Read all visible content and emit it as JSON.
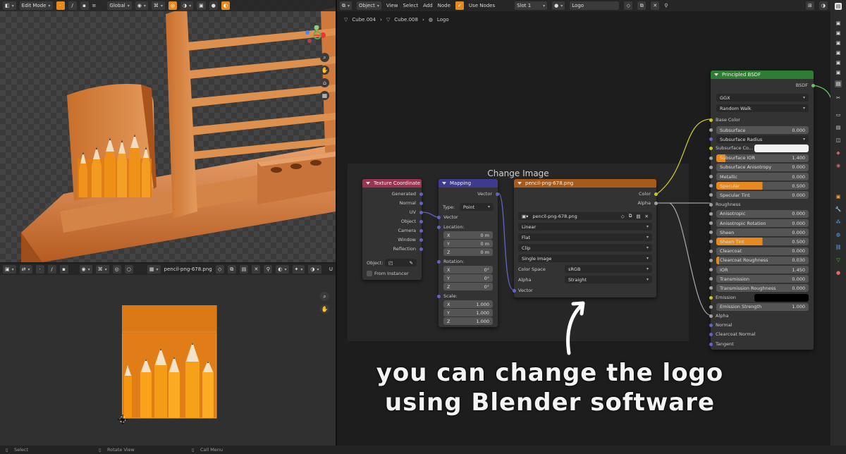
{
  "viewport": {
    "mode": "Edit Mode",
    "orientation": "Global"
  },
  "image_editor": {
    "image_name": "pencil-png-678.png",
    "status_select": "Select",
    "status_rotate": "Rotate View",
    "status_call": "Call Menu",
    "label_u": "U"
  },
  "node_editor": {
    "object_menu": "Object",
    "menu_view": "View",
    "menu_select": "Select",
    "menu_add": "Add",
    "menu_node": "Node",
    "use_nodes": "Use Nodes",
    "slot": "Slot 1",
    "material": "Logo",
    "breadcrumb": [
      "Cube.004",
      "Cube.008",
      "Logo"
    ],
    "frame_label": "Change Image"
  },
  "texcoord": {
    "title": "Texture Coordinate",
    "outputs": [
      "Generated",
      "Normal",
      "UV",
      "Object",
      "Camera",
      "Window",
      "Reflection"
    ],
    "object_label": "Object:",
    "from_instancer": "From Instancer"
  },
  "mapping": {
    "title": "Mapping",
    "vector_out": "Vector",
    "type_label": "Type:",
    "type_value": "Point",
    "vector_in": "Vector",
    "location": "Location:",
    "loc": [
      {
        "k": "X",
        "v": "0 m"
      },
      {
        "k": "Y",
        "v": "0 m"
      },
      {
        "k": "Z",
        "v": "0 m"
      }
    ],
    "rotation": "Rotation:",
    "rot": [
      {
        "k": "X",
        "v": "0°"
      },
      {
        "k": "Y",
        "v": "0°"
      },
      {
        "k": "Z",
        "v": "0°"
      }
    ],
    "scale": "Scale:",
    "scl": [
      {
        "k": "X",
        "v": "1.000"
      },
      {
        "k": "Y",
        "v": "1.000"
      },
      {
        "k": "Z",
        "v": "1.000"
      }
    ]
  },
  "imgtex": {
    "title": "pencil-png-678.png",
    "out_color": "Color",
    "out_alpha": "Alpha",
    "image": "pencil-png-678.png",
    "interp": "Linear",
    "proj": "Flat",
    "ext": "Clip",
    "source": "Single Image",
    "cs_label": "Color Space",
    "cs_value": "sRGB",
    "alpha_label": "Alpha",
    "alpha_value": "Straight",
    "vector_in": "Vector"
  },
  "bsdf": {
    "title": "Principled BSDF",
    "out": "BSDF",
    "dist": "GGX",
    "sss_method": "Random Walk",
    "base_color": "Base Color",
    "rows": [
      {
        "label": "Subsurface",
        "value": "0.000",
        "fill": 0
      },
      {
        "label": "Subsurface Radius",
        "value": "",
        "fill": 0
      },
      {
        "label": "Subsurface Co...",
        "value": "",
        "fill": 0
      },
      {
        "label": "Subsurface IOR",
        "value": "1.400",
        "fill": 0.1
      },
      {
        "label": "Subsurface Anisotropy",
        "value": "0.000",
        "fill": 0
      },
      {
        "label": "Metallic",
        "value": "0.000",
        "fill": 0
      },
      {
        "label": "Specular",
        "value": "0.500",
        "fill": 0.5
      },
      {
        "label": "Specular Tint",
        "value": "0.000",
        "fill": 0
      },
      {
        "label": "Roughness",
        "value": "",
        "fill": 0
      },
      {
        "label": "Anisotropic",
        "value": "0.000",
        "fill": 0
      },
      {
        "label": "Anisotropic Rotation",
        "value": "0.000",
        "fill": 0
      },
      {
        "label": "Sheen",
        "value": "0.000",
        "fill": 0
      },
      {
        "label": "Sheen Tint",
        "value": "0.500",
        "fill": 0.5
      },
      {
        "label": "Clearcoat",
        "value": "0.000",
        "fill": 0
      },
      {
        "label": "Clearcoat Roughness",
        "value": "0.030",
        "fill": 0.03
      },
      {
        "label": "IOR",
        "value": "1.450",
        "fill": 0
      },
      {
        "label": "Transmission",
        "value": "0.000",
        "fill": 0
      },
      {
        "label": "Transmission Roughness",
        "value": "0.000",
        "fill": 0
      },
      {
        "label": "Emission",
        "value": "",
        "fill": 0
      },
      {
        "label": "Emission Strength",
        "value": "1.000",
        "fill": 0
      },
      {
        "label": "Alpha",
        "value": "",
        "fill": 0
      },
      {
        "label": "Normal",
        "value": "",
        "fill": 0
      },
      {
        "label": "Clearcoat Normal",
        "value": "",
        "fill": 0
      },
      {
        "label": "Tangent",
        "value": "",
        "fill": 0
      }
    ]
  },
  "caption": {
    "line1": "you can change the logo",
    "line2": "using Blender software"
  },
  "colors": {
    "accent": "#e68a1f",
    "texcoord_header": "#9b3451",
    "mapping_header": "#3e3b8f",
    "imgtex_header": "#a85a1a",
    "bsdf_header": "#2f7d32"
  }
}
